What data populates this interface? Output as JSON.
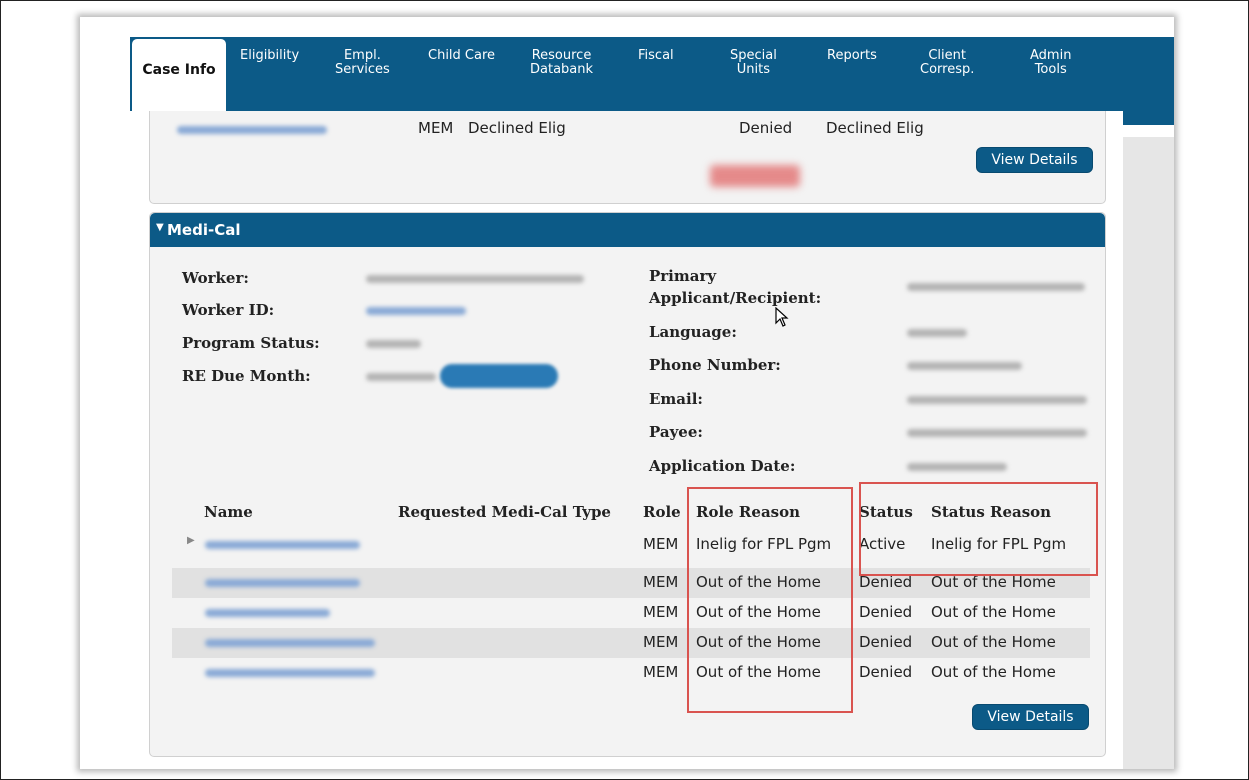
{
  "nav": {
    "tabs": [
      {
        "label": "Case Info",
        "active": true
      },
      {
        "label": "Eligibility"
      },
      {
        "label": "Empl.\nServices"
      },
      {
        "label": "Child Care"
      },
      {
        "label": "Resource\nDatabank"
      },
      {
        "label": "Fiscal"
      },
      {
        "label": "Special\nUnits"
      },
      {
        "label": "Reports"
      },
      {
        "label": "Client\nCorresp."
      },
      {
        "label": "Admin\nTools"
      }
    ]
  },
  "top_panel": {
    "row": {
      "role": "MEM",
      "role_reason": "Declined Elig",
      "status": "Denied",
      "status_reason": "Declined Elig"
    },
    "view_details": "View Details"
  },
  "medical": {
    "title": "Medi-Cal",
    "left_labels": {
      "worker": "Worker:",
      "worker_id": "Worker ID:",
      "program_status": "Program Status:",
      "re_due_month": "RE Due Month:"
    },
    "right_labels": {
      "primary": "Primary",
      "applicant": "Applicant/Recipient:",
      "language": "Language:",
      "phone": "Phone Number:",
      "email": "Email:",
      "payee": "Payee:",
      "application_date": "Application Date:"
    },
    "table": {
      "headers": {
        "name": "Name",
        "type": "Requested Medi-Cal Type",
        "role": "Role",
        "role_reason": "Role Reason",
        "status": "Status",
        "status_reason": "Status Reason"
      },
      "rows": [
        {
          "role": "MEM",
          "role_reason": "Inelig for FPL Pgm",
          "status": "Active",
          "status_reason": "Inelig for FPL Pgm"
        },
        {
          "role": "MEM",
          "role_reason": "Out of the Home",
          "status": "Denied",
          "status_reason": "Out of the Home"
        },
        {
          "role": "MEM",
          "role_reason": "Out of the Home",
          "status": "Denied",
          "status_reason": "Out of the Home"
        },
        {
          "role": "MEM",
          "role_reason": "Out of the Home",
          "status": "Denied",
          "status_reason": "Out of the Home"
        },
        {
          "role": "MEM",
          "role_reason": "Out of the Home",
          "status": "Denied",
          "status_reason": "Out of the Home"
        }
      ]
    },
    "view_details": "View Details"
  },
  "colors": {
    "nav_blue": "#0c5a87",
    "highlight_red": "#d9534f",
    "row_stripe": "#e1e1e1"
  }
}
